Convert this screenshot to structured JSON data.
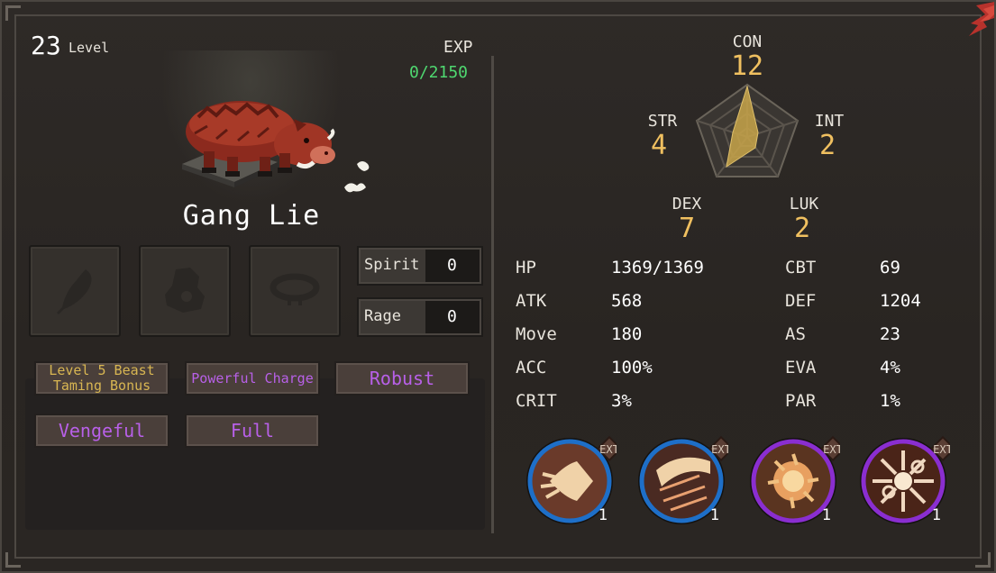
{
  "header": {
    "level_value": "23",
    "level_label": "Level",
    "exp_label": "EXP",
    "exp_value": "0/2150"
  },
  "pet": {
    "name": "Gang Lie",
    "icon": "boar-sprite"
  },
  "equipment_slots": [
    {
      "icon": "feather-icon"
    },
    {
      "icon": "armor-icon"
    },
    {
      "icon": "collar-icon"
    }
  ],
  "resources": [
    {
      "label": "Spirit",
      "value": "0"
    },
    {
      "label": "Rage",
      "value": "0"
    }
  ],
  "traits": [
    {
      "label": "Level 5 Beast Taming Bonus",
      "color": "#d8b652"
    },
    {
      "label": "Powerful Charge",
      "color": "#b860e8"
    },
    {
      "label": "Robust",
      "color": "#b860e8"
    },
    {
      "label": "Vengeful",
      "color": "#b860e8"
    },
    {
      "label": "Full",
      "color": "#b860e8"
    }
  ],
  "attributes": {
    "con": {
      "label": "CON",
      "value": "12"
    },
    "str": {
      "label": "STR",
      "value": "4"
    },
    "int": {
      "label": "INT",
      "value": "2"
    },
    "dex": {
      "label": "DEX",
      "value": "7"
    },
    "luk": {
      "label": "LUK",
      "value": "2"
    }
  },
  "stats_left": [
    {
      "label": "HP",
      "value": "1369/1369"
    },
    {
      "label": "ATK",
      "value": "568"
    },
    {
      "label": "Move",
      "value": "180"
    },
    {
      "label": "ACC",
      "value": "100%"
    },
    {
      "label": "CRIT",
      "value": "3%"
    }
  ],
  "stats_right": [
    {
      "label": "CBT",
      "value": "69"
    },
    {
      "label": "DEF",
      "value": "1204"
    },
    {
      "label": "AS",
      "value": "23"
    },
    {
      "label": "EVA",
      "value": "4%"
    },
    {
      "label": "PAR",
      "value": "1%"
    }
  ],
  "skills": [
    {
      "icon": "charge-skill-icon",
      "badge": "EXT",
      "level": "1",
      "ring_color": "#1e6fc8"
    },
    {
      "icon": "slash-skill-icon",
      "badge": "EXT",
      "level": "1",
      "ring_color": "#1e6fc8"
    },
    {
      "icon": "burst-skill-icon",
      "badge": "EXT",
      "level": "1",
      "ring_color": "#8a2ed0"
    },
    {
      "icon": "shatter-skill-icon",
      "badge": "EXT",
      "level": "1",
      "ring_color": "#8a2ed0"
    }
  ],
  "colors": {
    "exp_green": "#4fd870",
    "attr_gold": "#f0c060",
    "trait_gold": "#d8b652",
    "trait_purple": "#b860e8"
  }
}
